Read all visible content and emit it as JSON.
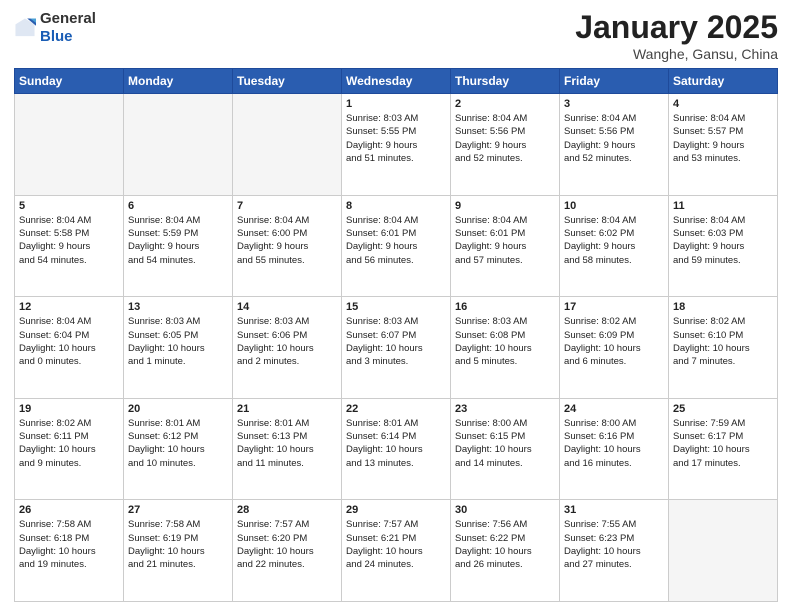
{
  "header": {
    "logo_line1": "General",
    "logo_line2": "Blue",
    "title": "January 2025",
    "subtitle": "Wanghe, Gansu, China"
  },
  "weekdays": [
    "Sunday",
    "Monday",
    "Tuesday",
    "Wednesday",
    "Thursday",
    "Friday",
    "Saturday"
  ],
  "weeks": [
    [
      {
        "day": "",
        "info": ""
      },
      {
        "day": "",
        "info": ""
      },
      {
        "day": "",
        "info": ""
      },
      {
        "day": "1",
        "info": "Sunrise: 8:03 AM\nSunset: 5:55 PM\nDaylight: 9 hours\nand 51 minutes."
      },
      {
        "day": "2",
        "info": "Sunrise: 8:04 AM\nSunset: 5:56 PM\nDaylight: 9 hours\nand 52 minutes."
      },
      {
        "day": "3",
        "info": "Sunrise: 8:04 AM\nSunset: 5:56 PM\nDaylight: 9 hours\nand 52 minutes."
      },
      {
        "day": "4",
        "info": "Sunrise: 8:04 AM\nSunset: 5:57 PM\nDaylight: 9 hours\nand 53 minutes."
      }
    ],
    [
      {
        "day": "5",
        "info": "Sunrise: 8:04 AM\nSunset: 5:58 PM\nDaylight: 9 hours\nand 54 minutes."
      },
      {
        "day": "6",
        "info": "Sunrise: 8:04 AM\nSunset: 5:59 PM\nDaylight: 9 hours\nand 54 minutes."
      },
      {
        "day": "7",
        "info": "Sunrise: 8:04 AM\nSunset: 6:00 PM\nDaylight: 9 hours\nand 55 minutes."
      },
      {
        "day": "8",
        "info": "Sunrise: 8:04 AM\nSunset: 6:01 PM\nDaylight: 9 hours\nand 56 minutes."
      },
      {
        "day": "9",
        "info": "Sunrise: 8:04 AM\nSunset: 6:01 PM\nDaylight: 9 hours\nand 57 minutes."
      },
      {
        "day": "10",
        "info": "Sunrise: 8:04 AM\nSunset: 6:02 PM\nDaylight: 9 hours\nand 58 minutes."
      },
      {
        "day": "11",
        "info": "Sunrise: 8:04 AM\nSunset: 6:03 PM\nDaylight: 9 hours\nand 59 minutes."
      }
    ],
    [
      {
        "day": "12",
        "info": "Sunrise: 8:04 AM\nSunset: 6:04 PM\nDaylight: 10 hours\nand 0 minutes."
      },
      {
        "day": "13",
        "info": "Sunrise: 8:03 AM\nSunset: 6:05 PM\nDaylight: 10 hours\nand 1 minute."
      },
      {
        "day": "14",
        "info": "Sunrise: 8:03 AM\nSunset: 6:06 PM\nDaylight: 10 hours\nand 2 minutes."
      },
      {
        "day": "15",
        "info": "Sunrise: 8:03 AM\nSunset: 6:07 PM\nDaylight: 10 hours\nand 3 minutes."
      },
      {
        "day": "16",
        "info": "Sunrise: 8:03 AM\nSunset: 6:08 PM\nDaylight: 10 hours\nand 5 minutes."
      },
      {
        "day": "17",
        "info": "Sunrise: 8:02 AM\nSunset: 6:09 PM\nDaylight: 10 hours\nand 6 minutes."
      },
      {
        "day": "18",
        "info": "Sunrise: 8:02 AM\nSunset: 6:10 PM\nDaylight: 10 hours\nand 7 minutes."
      }
    ],
    [
      {
        "day": "19",
        "info": "Sunrise: 8:02 AM\nSunset: 6:11 PM\nDaylight: 10 hours\nand 9 minutes."
      },
      {
        "day": "20",
        "info": "Sunrise: 8:01 AM\nSunset: 6:12 PM\nDaylight: 10 hours\nand 10 minutes."
      },
      {
        "day": "21",
        "info": "Sunrise: 8:01 AM\nSunset: 6:13 PM\nDaylight: 10 hours\nand 11 minutes."
      },
      {
        "day": "22",
        "info": "Sunrise: 8:01 AM\nSunset: 6:14 PM\nDaylight: 10 hours\nand 13 minutes."
      },
      {
        "day": "23",
        "info": "Sunrise: 8:00 AM\nSunset: 6:15 PM\nDaylight: 10 hours\nand 14 minutes."
      },
      {
        "day": "24",
        "info": "Sunrise: 8:00 AM\nSunset: 6:16 PM\nDaylight: 10 hours\nand 16 minutes."
      },
      {
        "day": "25",
        "info": "Sunrise: 7:59 AM\nSunset: 6:17 PM\nDaylight: 10 hours\nand 17 minutes."
      }
    ],
    [
      {
        "day": "26",
        "info": "Sunrise: 7:58 AM\nSunset: 6:18 PM\nDaylight: 10 hours\nand 19 minutes."
      },
      {
        "day": "27",
        "info": "Sunrise: 7:58 AM\nSunset: 6:19 PM\nDaylight: 10 hours\nand 21 minutes."
      },
      {
        "day": "28",
        "info": "Sunrise: 7:57 AM\nSunset: 6:20 PM\nDaylight: 10 hours\nand 22 minutes."
      },
      {
        "day": "29",
        "info": "Sunrise: 7:57 AM\nSunset: 6:21 PM\nDaylight: 10 hours\nand 24 minutes."
      },
      {
        "day": "30",
        "info": "Sunrise: 7:56 AM\nSunset: 6:22 PM\nDaylight: 10 hours\nand 26 minutes."
      },
      {
        "day": "31",
        "info": "Sunrise: 7:55 AM\nSunset: 6:23 PM\nDaylight: 10 hours\nand 27 minutes."
      },
      {
        "day": "",
        "info": ""
      }
    ]
  ],
  "colors": {
    "header_bg": "#2a5db0",
    "header_text": "#ffffff",
    "border": "#cccccc",
    "empty_bg": "#f5f5f5"
  }
}
